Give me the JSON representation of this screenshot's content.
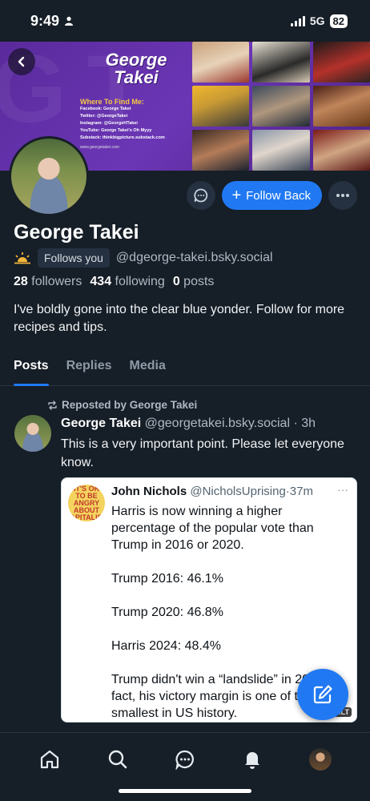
{
  "status": {
    "time": "9:49",
    "network": "5G",
    "battery": "82"
  },
  "banner": {
    "name_line1": "George",
    "name_line2": "Takei",
    "where_title": "Where To Find Me:",
    "lines": [
      "Facebook: George Takei",
      "Twitter: @GeorgeTakei",
      "Instagram: @GeorgeHTakei",
      "YouTube: George Takei's Oh Myyy",
      "Substack: thinkbigpicture.substack.com"
    ],
    "site": "www.georgetakei.com"
  },
  "profile": {
    "display_name": "George Takei",
    "follows_you": "Follows you",
    "handle": "@dgeorge-takei.bsky.social",
    "followers_count": "28",
    "followers_label": "followers",
    "following_count": "434",
    "following_label": "following",
    "posts_count": "0",
    "posts_label": "posts",
    "bio": "I've boldly gone into the clear blue yonder. Follow for more recipes and tips.",
    "follow_back_label": "Follow Back"
  },
  "tabs": [
    {
      "label": "Posts",
      "active": true
    },
    {
      "label": "Replies",
      "active": false
    },
    {
      "label": "Media",
      "active": false
    }
  ],
  "post": {
    "repost_label": "Reposted by George Takei",
    "author_name": "George Takei",
    "author_handle": "@georgetakei.bsky.social",
    "time": "3h",
    "text": "This is a very important point. Please let everyone know.",
    "embed": {
      "avatar_text": [
        "IT'S OK",
        "TO BE",
        "ANGRY",
        "ABOUT",
        "CAPITALISM"
      ],
      "author_name": "John Nichols",
      "author_handle": "@NicholsUprising",
      "time": "37m",
      "paragraphs": [
        "Harris is now winning a higher percentage of the popular vote than Trump in 2016 or 2020.",
        "Trump 2016: 46.1%",
        "Trump 2020: 46.8%",
        "Harris 2024: 48.4%",
        "Trump didn't win a “landslide” in 2024. In fact, his victory margin is one of the smallest in US history."
      ],
      "alt_badge": "ALT"
    }
  },
  "colors": {
    "accent": "#2079f2",
    "background": "#161e27",
    "banner": "#6b36b5"
  }
}
